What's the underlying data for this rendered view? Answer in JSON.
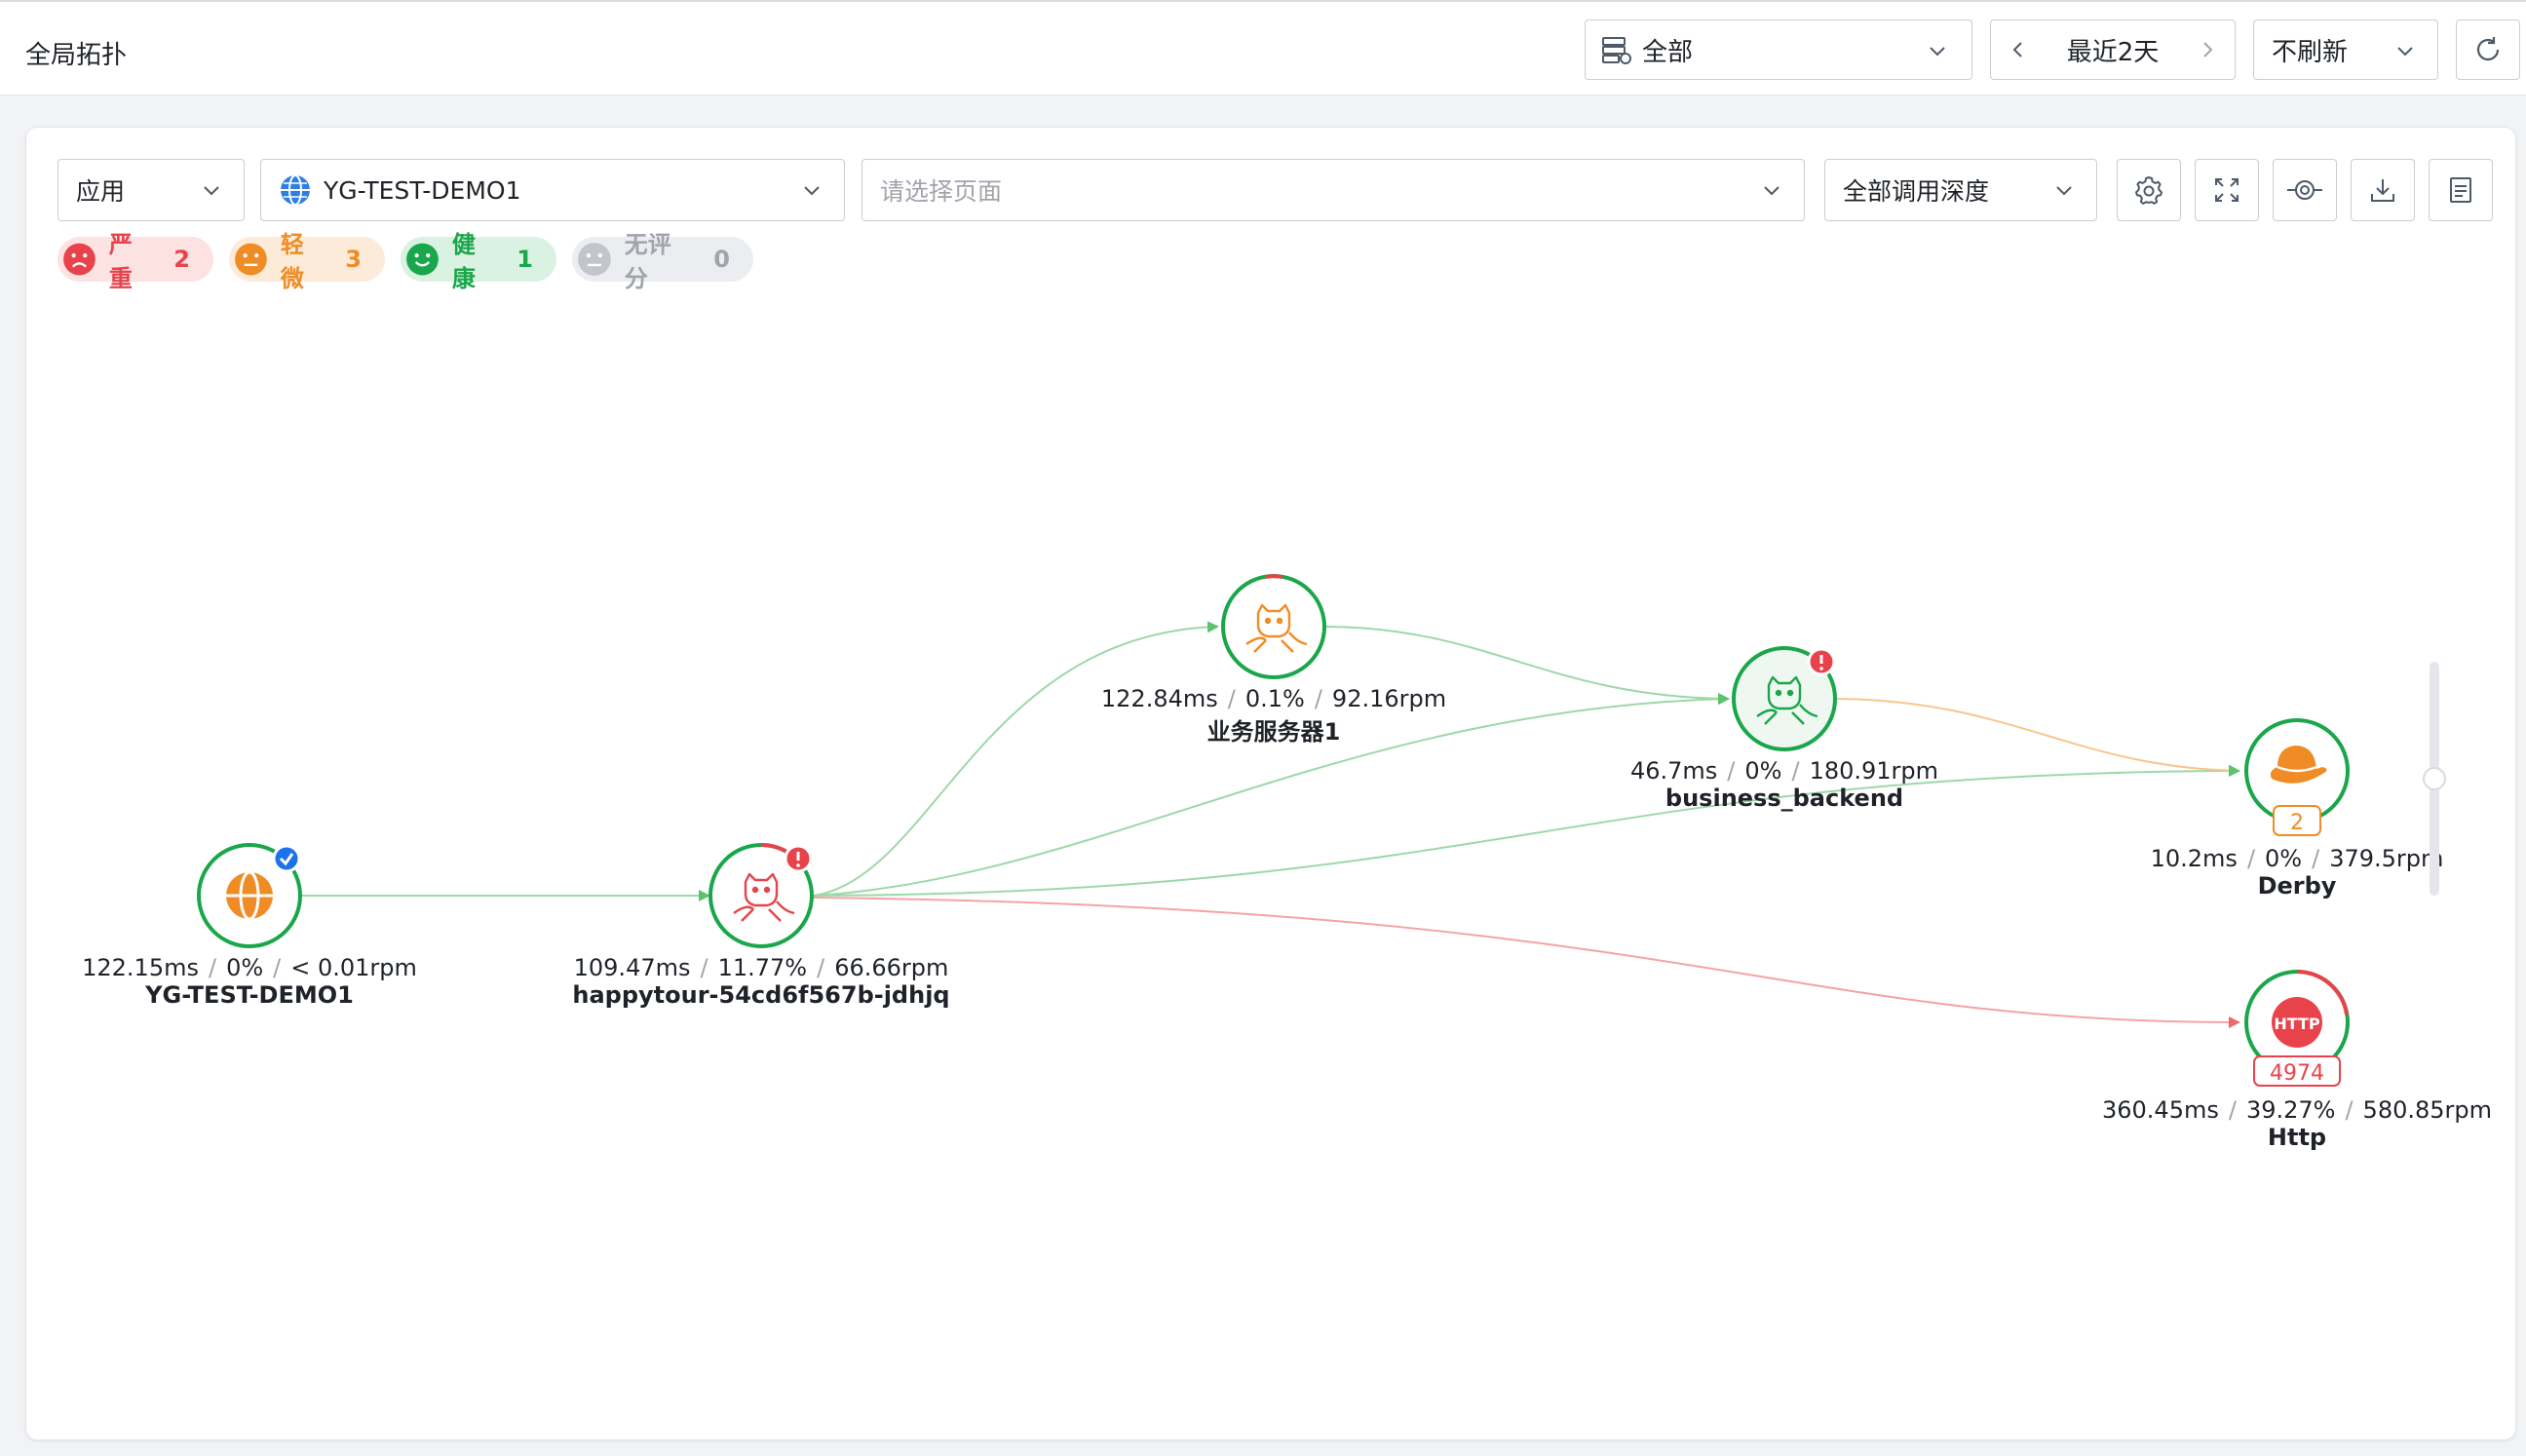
{
  "header": {
    "title": "全局拓扑",
    "env_select": "全部",
    "time_range": "最近2天",
    "refresh_select": "不刷新"
  },
  "toolbar": {
    "type_select": "应用",
    "app_select": "YG-TEST-DEMO1",
    "page_placeholder": "请选择页面",
    "depth_select": "全部调用深度"
  },
  "legend": [
    {
      "label": "严重",
      "count": "2"
    },
    {
      "label": "轻微",
      "count": "3"
    },
    {
      "label": "健康",
      "count": "1"
    },
    {
      "label": "无评分",
      "count": "0"
    }
  ],
  "colors": {
    "severe": "#e8434b",
    "minor": "#f08c25",
    "healthy": "#1aa64a",
    "none": "#a0a4ab",
    "edge_ok": "#9dd8a9",
    "edge_warn": "#f9c58f",
    "edge_err": "#f3a4a4"
  },
  "nodes": {
    "demo": {
      "name": "YG-TEST-DEMO1",
      "latency": "122.15ms",
      "error": "0%",
      "rpm": "< 0.01rpm",
      "icon": "globe-icon"
    },
    "happytour": {
      "name": "happytour-54cd6f567b-jdhjq",
      "latency": "109.47ms",
      "error": "11.77%",
      "rpm": "66.66rpm",
      "icon": "tomcat-icon"
    },
    "biz1": {
      "name": "业务服务器1",
      "latency": "122.84ms",
      "error": "0.1%",
      "rpm": "92.16rpm",
      "icon": "tomcat-icon"
    },
    "backend": {
      "name": "business_backend",
      "latency": "46.7ms",
      "error": "0%",
      "rpm": "180.91rpm",
      "icon": "tomcat-icon"
    },
    "derby": {
      "name": "Derby",
      "latency": "10.2ms",
      "error": "0%",
      "rpm": "379.5rpm",
      "icon": "derby-hat-icon",
      "badge": "2"
    },
    "http": {
      "name": "Http",
      "latency": "360.45ms",
      "error": "39.27%",
      "rpm": "580.85rpm",
      "icon": "http-icon",
      "badge": "4974",
      "icon_text": "HTTP"
    }
  }
}
